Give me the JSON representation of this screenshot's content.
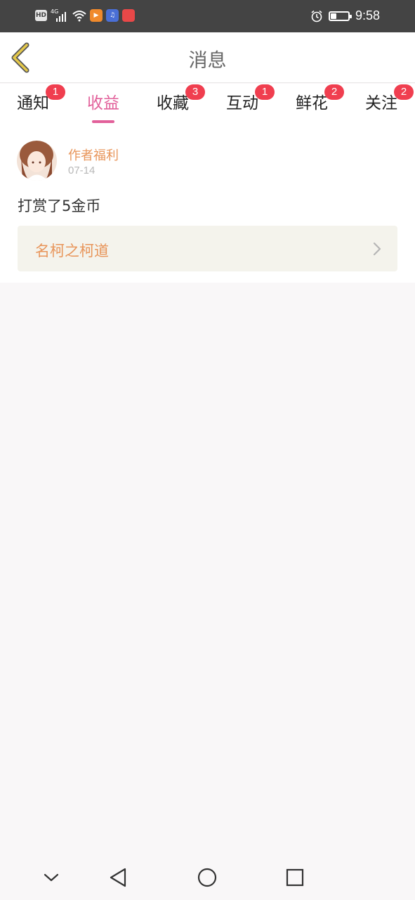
{
  "status_bar": {
    "hd_label": "HD",
    "network_label": "4G",
    "time": "9:58",
    "battery_level_fraction": 0.3,
    "icons": [
      "hd-icon",
      "signal-icon",
      "wifi-icon",
      "video-app-icon",
      "music-app-icon",
      "red-app-icon",
      "alarm-icon",
      "battery-icon"
    ]
  },
  "header": {
    "title": "消息",
    "back_icon": "chevron-left-icon"
  },
  "tabs": [
    {
      "label": "通知",
      "badge": "1",
      "active": false
    },
    {
      "label": "收益",
      "badge": "",
      "active": true
    },
    {
      "label": "收藏",
      "badge": "3",
      "active": false
    },
    {
      "label": "互动",
      "badge": "1",
      "active": false
    },
    {
      "label": "鲜花",
      "badge": "2",
      "active": false
    },
    {
      "label": "关注",
      "badge": "2",
      "active": false
    }
  ],
  "message": {
    "sender": "作者福利",
    "date": "07-14",
    "text": "打赏了5金币",
    "book_title": "名柯之柯道"
  },
  "nav_bar": {
    "icons": [
      "collapse-icon",
      "back-triangle-icon",
      "home-circle-icon",
      "recents-square-icon"
    ]
  },
  "colors": {
    "accent": "#e2609a",
    "badge": "#f03e4f",
    "orange_text": "#e8955a",
    "status_bar_bg": "#444444",
    "back_arrow": "#e4c84a"
  }
}
